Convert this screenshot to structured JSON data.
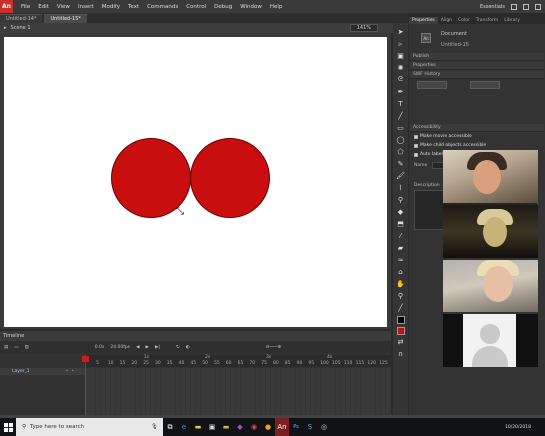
{
  "menubar": {
    "logo": "An",
    "items": [
      "File",
      "Edit",
      "View",
      "Insert",
      "Modify",
      "Text",
      "Commands",
      "Control",
      "Debug",
      "Window",
      "Help"
    ],
    "workspace": "Essentials"
  },
  "tabs": [
    "Untitled-14*",
    "Untitled-15*"
  ],
  "editbar": {
    "scene": "Scene 1",
    "zoom": "141%"
  },
  "panel": {
    "tabs": [
      "Properties",
      "Align",
      "Color",
      "Transform",
      "Library"
    ],
    "doc_icon": "An",
    "doc_type": "Document",
    "doc_name": "Untitled-15",
    "sections": {
      "publish": "Publish",
      "properties": "Properties",
      "swf_history": "SWF History",
      "accessibility": "Accessibility"
    },
    "checks": [
      "Make movie accessible",
      "Make child objects accessible",
      "Auto label"
    ],
    "name_label": "Name",
    "description_label": "Description"
  },
  "timeline": {
    "title": "Timeline",
    "fps": "24.00",
    "fps_unit": "fps",
    "frame": "0.0",
    "frame_unit": "s",
    "seconds": [
      "1s",
      "2s",
      "3s",
      "4s"
    ],
    "ruler": [
      "5",
      "10",
      "15",
      "20",
      "25",
      "30",
      "35",
      "40",
      "45",
      "50",
      "55",
      "60",
      "65",
      "70",
      "75",
      "80",
      "85",
      "90",
      "95",
      "100",
      "105",
      "110",
      "115",
      "120",
      "125"
    ],
    "layer": "Layer_1"
  },
  "taskbar": {
    "search_placeholder": "Type here to search",
    "time": "10/20/2018"
  },
  "colors": {
    "fill": "#c80e0e",
    "stroke": "#6b0000",
    "accent": "#c8302c"
  }
}
